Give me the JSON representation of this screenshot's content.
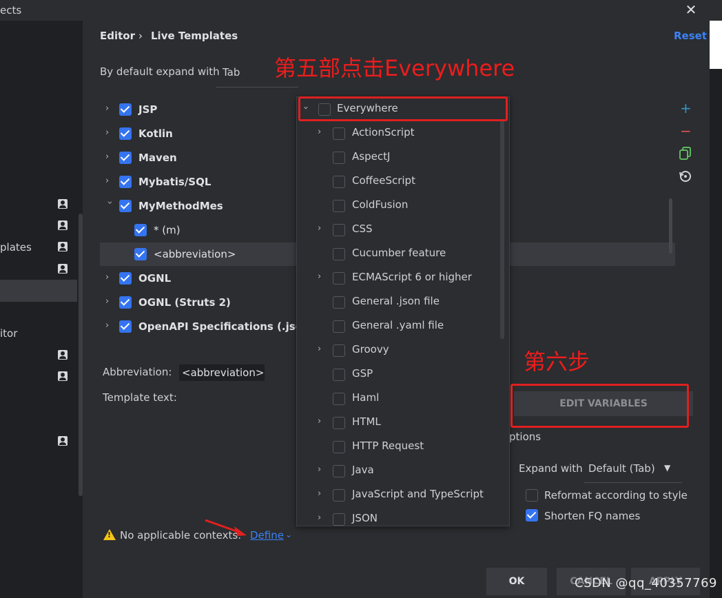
{
  "window": {
    "title_partial": "ects"
  },
  "sidebar": {
    "items": [
      {
        "label": "plates"
      },
      {
        "label": "itor"
      }
    ]
  },
  "breadcrumb": {
    "first": "Editor",
    "separator": "›",
    "second": "Live Templates"
  },
  "header": {
    "reset_label": "Reset"
  },
  "expand_default": {
    "label": "By default expand with",
    "value": "Tab"
  },
  "tree": {
    "items": [
      {
        "label": "JSP"
      },
      {
        "label": "Kotlin"
      },
      {
        "label": "Maven"
      },
      {
        "label": "Mybatis/SQL"
      },
      {
        "label": "MyMethodMes"
      },
      {
        "label": "* (m)"
      },
      {
        "label": "<abbreviation>"
      },
      {
        "label": "OGNL"
      },
      {
        "label": "OGNL (Struts 2)"
      },
      {
        "label": "OpenAPI Specifications (.json)"
      }
    ]
  },
  "toolbar": {
    "add": "+",
    "remove": "−"
  },
  "editor": {
    "abbreviation_label": "Abbreviation:",
    "abbreviation_value": "<abbreviation>",
    "template_text_label": "Template text:"
  },
  "popup": {
    "items": [
      {
        "label": "Everywhere"
      },
      {
        "label": "ActionScript"
      },
      {
        "label": "AspectJ"
      },
      {
        "label": "CoffeeScript"
      },
      {
        "label": "ColdFusion"
      },
      {
        "label": "CSS"
      },
      {
        "label": "Cucumber feature"
      },
      {
        "label": "ECMAScript 6 or higher"
      },
      {
        "label": "General .json file"
      },
      {
        "label": "General .yaml file"
      },
      {
        "label": "Groovy"
      },
      {
        "label": "GSP"
      },
      {
        "label": "Haml"
      },
      {
        "label": "HTML"
      },
      {
        "label": "HTTP Request"
      },
      {
        "label": "Java"
      },
      {
        "label": "JavaScript and TypeScript"
      },
      {
        "label": "JSON"
      }
    ]
  },
  "annotations": {
    "step5": "第五部点击Everywhere",
    "step6": "第六步"
  },
  "options": {
    "edit_variables": "EDIT VARIABLES",
    "options_label_partial": "ptions",
    "expand_with_label": "Expand with",
    "expand_with_value": "Default (Tab)",
    "reformat_label": "Reformat according to style",
    "shorten_label": "Shorten FQ names"
  },
  "status": {
    "warning_text": "No applicable contexts.",
    "define_label": "Define"
  },
  "buttons": {
    "ok": "OK",
    "cancel_partial": "CANCEL",
    "apply_partial": "APPLY"
  },
  "watermark": "CSDN @qq_40357769",
  "colors": {
    "accent": "#3574f0",
    "link": "#3b82f6",
    "annotation": "#ee1c1c",
    "warning": "#f5c518"
  }
}
